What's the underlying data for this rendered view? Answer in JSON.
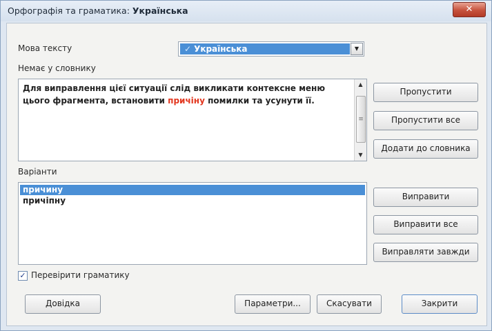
{
  "window": {
    "title_prefix": "Орфографія та граматика: ",
    "title_lang": "Українська",
    "close_glyph": "✕"
  },
  "language": {
    "label": "Мова тексту",
    "selected": "Українська"
  },
  "not_in_dictionary": {
    "label": "Немає у словнику",
    "text_before": "Для виправлення цієї ситуації слід викликати контексне меню цього фрагмента, встановити ",
    "error_word": "причіну",
    "text_after": " помилки та усунути її."
  },
  "variants": {
    "label": "Варіанти",
    "items": [
      "причину",
      "причіпну"
    ]
  },
  "right_buttons": {
    "skip": "Пропустити",
    "skip_all": "Пропустити все",
    "add_to_dictionary": "Додати до словника",
    "correct": "Виправити",
    "correct_all": "Виправити все",
    "always_correct": "Виправляти завжди"
  },
  "grammar_check": {
    "label": "Перевірити граматику",
    "checked": true
  },
  "bottom_buttons": {
    "help": "Довідка",
    "options": "Параметри...",
    "cancel": "Скасувати",
    "close": "Закрити"
  },
  "colors": {
    "selection": "#4a8fd6",
    "error_text": "#e2361e",
    "close_button": "#c6523d"
  }
}
